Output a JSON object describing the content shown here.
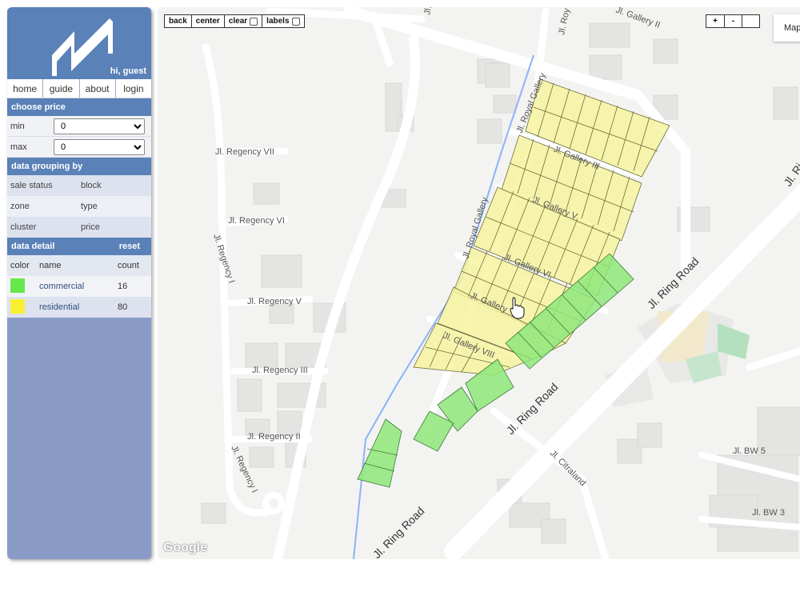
{
  "header": {
    "greeting": "hi, guest"
  },
  "nav": [
    {
      "label": "home"
    },
    {
      "label": "guide"
    },
    {
      "label": "about"
    },
    {
      "label": "login"
    }
  ],
  "price": {
    "title": "choose price",
    "min_label": "min",
    "min_value": "0",
    "max_label": "max",
    "max_value": "0"
  },
  "grouping": {
    "title": "data grouping by",
    "options": [
      [
        "sale status",
        "block"
      ],
      [
        "zone",
        "type"
      ],
      [
        "cluster",
        "price"
      ]
    ]
  },
  "detail": {
    "title": "data detail",
    "reset_label": "reset",
    "columns": {
      "color": "color",
      "name": "name",
      "count": "count"
    },
    "rows": [
      {
        "name": "commercial",
        "count": "16",
        "color": "#66e84c"
      },
      {
        "name": "residential",
        "count": "80",
        "color": "#f7f032"
      }
    ]
  },
  "map": {
    "toolbar": {
      "back": "back",
      "center": "center",
      "clear": "clear",
      "labels": "labels"
    },
    "zoom": {
      "in": "+",
      "out": "-"
    },
    "maptype_label": "Map",
    "attribution": "Google",
    "street_labels": {
      "regency_vii": "Jl. Regency VII",
      "regency_vi": "Jl. Regency VI",
      "regency_v": "Jl. Regency V",
      "regency_iii": "Jl. Regency III",
      "regency_ii": "Jl. Regency II",
      "regency_i_top": "Jl. Regency I",
      "regency_i_bottom": "Jl. Regency I",
      "royal_gallery_top": "Jl. Royal Gallery",
      "royal_gallery_mid": "Jl. Royal Gallery",
      "gallery_ii": "Jl. Gallery II",
      "gallery_iii": "Jl. Gallery III",
      "gallery_v": "Jl. Gallery V",
      "gallery_vi": "Jl. Gallery VI",
      "gallery_viii": "Jl. Gallery VIII",
      "gallery_lower": "Jl. Gallery",
      "ring_road_right": "Jl. Ring Road",
      "ring_road_mid": "Jl. Ring Road",
      "ring_road_bottom": "Jl. Ring Road",
      "citraland": "Jl. Citraland",
      "bw5": "Jl. BW 5",
      "bw3": "Jl. BW 3",
      "top_a": "Jl. N",
      "top_b": "Jl. Roy",
      "top_right": "Jl. Ri"
    }
  }
}
